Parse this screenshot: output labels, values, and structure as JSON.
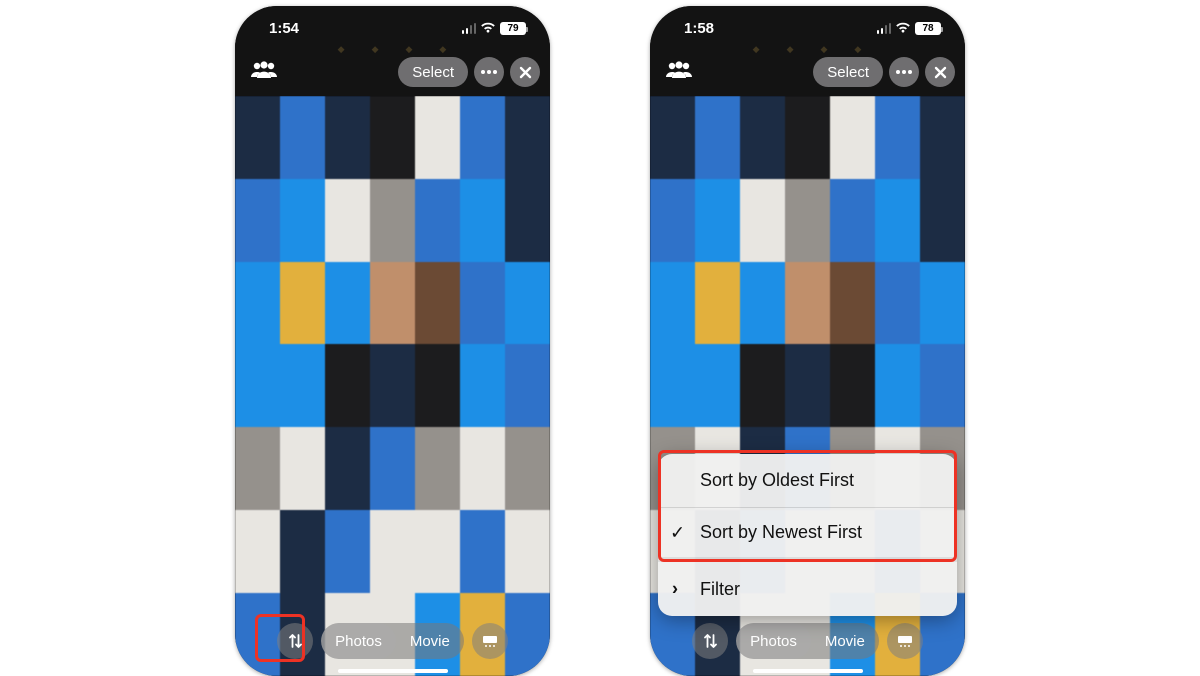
{
  "left": {
    "status": {
      "time": "1:54",
      "battery": "79"
    },
    "toolbar": {
      "select": "Select"
    },
    "bottom": {
      "seg_photos": "Photos",
      "seg_movie": "Movie"
    }
  },
  "right": {
    "status": {
      "time": "1:58",
      "battery": "78"
    },
    "toolbar": {
      "select": "Select"
    },
    "bottom": {
      "seg_photos": "Photos",
      "seg_movie": "Movie"
    },
    "menu": {
      "sort_oldest": "Sort by Oldest First",
      "sort_newest": "Sort by Newest First",
      "filter": "Filter",
      "selected": "newest"
    }
  }
}
